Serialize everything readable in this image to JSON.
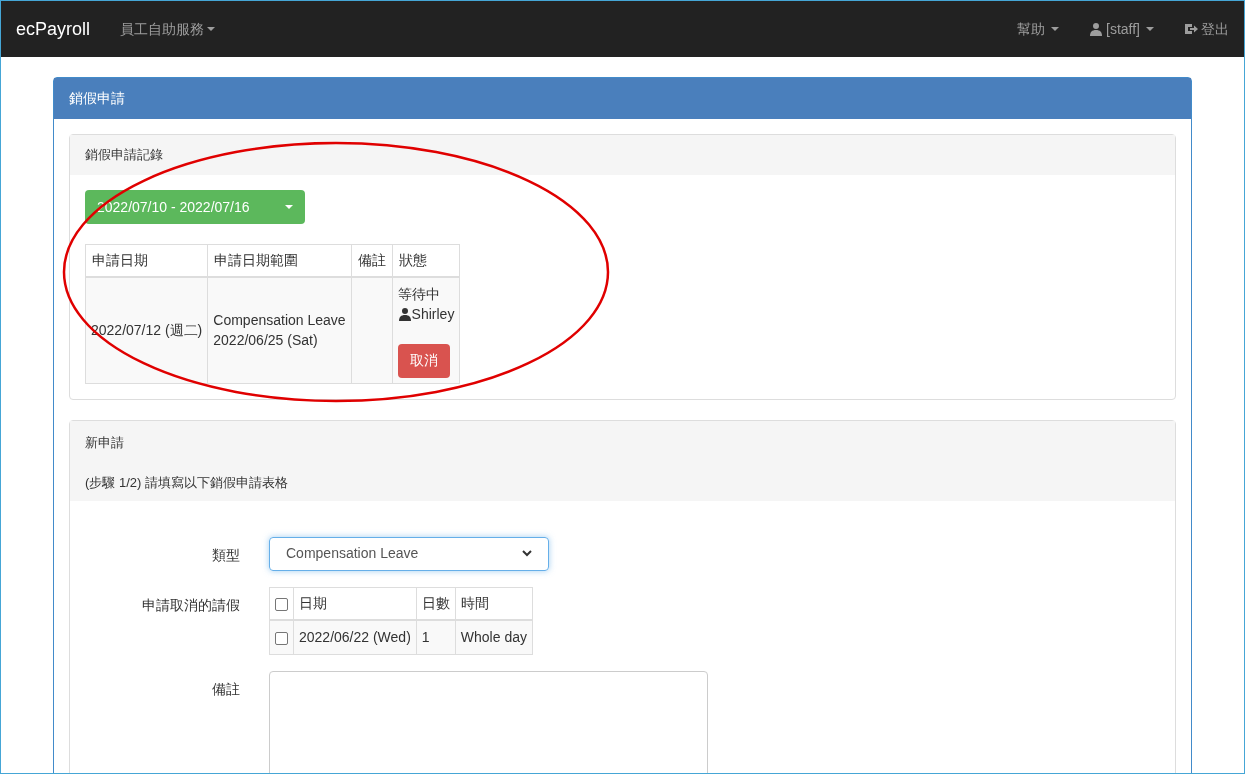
{
  "navbar": {
    "brand": "ecPayroll",
    "menu": [
      {
        "label": "員工自助服務"
      }
    ],
    "right": [
      {
        "kind": "menu",
        "label": "幫助"
      },
      {
        "kind": "user",
        "label": "[staff]"
      },
      {
        "kind": "logout",
        "label": "登出"
      }
    ]
  },
  "panel": {
    "title": "銷假申請",
    "records": {
      "title": "銷假申請記錄",
      "date_range": "2022/07/10 - 2022/07/16",
      "columns": [
        "申請日期",
        "申請日期範圍",
        "備註",
        "狀態"
      ],
      "rows": [
        {
          "date": "2022/07/12 (週二)",
          "range": [
            "Compensation Leave",
            "2022/06/25 (Sat)"
          ],
          "remark": "",
          "status": "等待中",
          "approver": "Shirley",
          "action": "取消"
        }
      ]
    },
    "new_request": {
      "title": "新申請",
      "step": "(步驟 1/2) 請填寫以下銷假申請表格",
      "type_label": "類型",
      "type_value": "Compensation Leave",
      "leave_label": "申請取消的請假",
      "leave_columns": [
        "日期",
        "日數",
        "時間"
      ],
      "header_checked": false,
      "leave_rows": [
        {
          "checked": false,
          "date": "2022/06/22 (Wed)",
          "days": "1",
          "time": "Whole day"
        }
      ],
      "remark_label": "備註"
    }
  }
}
